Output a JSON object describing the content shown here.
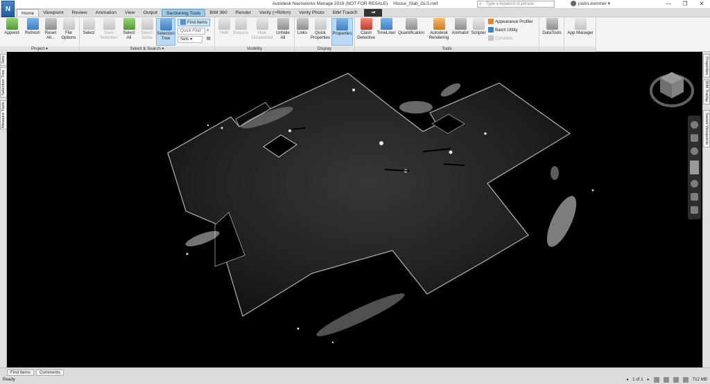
{
  "titlebar": {
    "app_icon": "N",
    "title": "Autodesk Navisworks Manage 2019 (NOT FOR RESALE)",
    "filename": "House_Slab_GLS.nwf",
    "search_placeholder": "Type a keyword or phrase",
    "user": "justin.dommer",
    "minimize": "—",
    "restore": "❐",
    "close": "✕"
  },
  "tabs": [
    "Home",
    "Viewpoint",
    "Review",
    "Animation",
    "View",
    "Output",
    "Sectioning Tools",
    "BIM 360",
    "Render",
    "Verity (+Rithm)",
    "Verity Photo",
    "BIM Track®"
  ],
  "ribbon": {
    "project": {
      "label": "Project ▾",
      "append": "Append",
      "refresh": "Refresh",
      "reset_all": "Reset All...",
      "file_options": "File Options"
    },
    "select_search": {
      "label": "Select & Search ▾",
      "select": "Select",
      "save_selection": "Save Selection",
      "select_all": "Select All",
      "select_same": "Select Same",
      "selection_tree": "Selection Tree",
      "find_items": "Find Items",
      "quick_find": "Quick Find",
      "sets": "Sets"
    },
    "visibility": {
      "label": "Visibility",
      "hide": "Hide",
      "require": "Require",
      "hide_unselected": "Hide Unselected",
      "unhide_all": "Unhide All"
    },
    "display": {
      "label": "Display",
      "links": "Links",
      "quick_properties": "Quick Properties",
      "properties": "Properties"
    },
    "tools": {
      "label": "Tools",
      "clash_detective": "Clash Detective",
      "timeliner": "TimeLiner",
      "quantification": "Quantification",
      "autodesk_rendering": "Autodesk Rendering",
      "animator": "Animator",
      "scripter": "Scripter",
      "appearance_profiler": "Appearance Profiler",
      "batch_utility": "Batch Utility",
      "compare": "Compare"
    },
    "datatools": "DataTools",
    "app_manager": "App Manager"
  },
  "left_side_tabs": [
    "Sets",
    "Selection Tree",
    "Measure Tools"
  ],
  "right_side_tabs": [
    "Properties",
    "BIM Track®",
    "Saved Viewpoints"
  ],
  "bottom_tabs": [
    "Find Items",
    "Comments"
  ],
  "status": {
    "ready": "Ready",
    "page": "1 of 1",
    "memory": "712 MB"
  }
}
